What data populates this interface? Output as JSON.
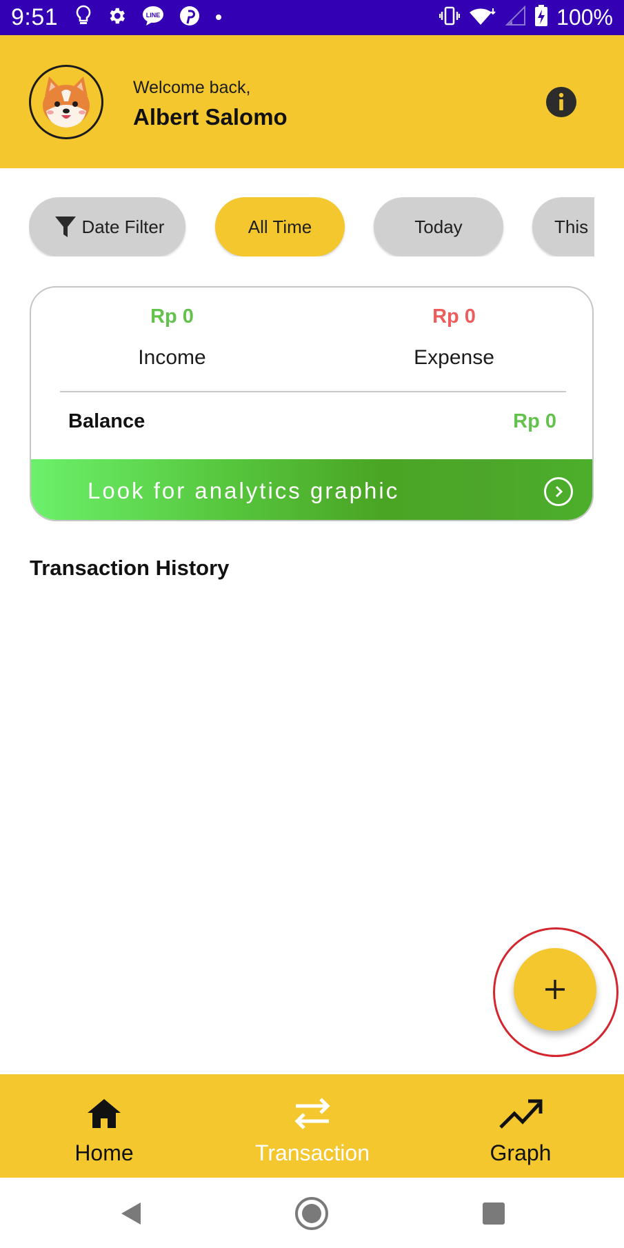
{
  "status_bar": {
    "time": "9:51",
    "battery": "100%",
    "left_icons": [
      "lightbulb-icon",
      "settings-icon",
      "line-icon",
      "pinterest-icon",
      "dot-icon"
    ],
    "right_icons": [
      "vibrate-icon",
      "wifi-icon",
      "signal-icon",
      "battery-charging-icon"
    ]
  },
  "header": {
    "welcome": "Welcome back,",
    "username": "Albert Salomo",
    "avatar_icon": "shiba-avatar",
    "info_icon": "info-icon"
  },
  "filters": {
    "date_filter": "Date Filter",
    "chips": [
      "All Time",
      "Today",
      "This"
    ],
    "selected": "All Time"
  },
  "summary": {
    "income_amount": "Rp 0",
    "income_label": "Income",
    "expense_amount": "Rp 0",
    "expense_label": "Expense",
    "balance_label": "Balance",
    "balance_value": "Rp 0",
    "analytics_cta": "Look for analytics graphic"
  },
  "history": {
    "title": "Transaction History",
    "items": []
  },
  "fab": {
    "icon": "plus-icon"
  },
  "bottom_nav": {
    "items": [
      {
        "label": "Home",
        "icon": "home-icon"
      },
      {
        "label": "Transaction",
        "icon": "swap-arrows-icon"
      },
      {
        "label": "Graph",
        "icon": "trending-up-icon"
      }
    ],
    "current": "Transaction"
  },
  "colors": {
    "status_bar": "#3300b3",
    "brand_yellow": "#f4c72f",
    "income_green": "#62c24b",
    "expense_red": "#ee5d5d",
    "chip_gray": "#d0d0d0",
    "highlight_red": "#d3262e"
  }
}
